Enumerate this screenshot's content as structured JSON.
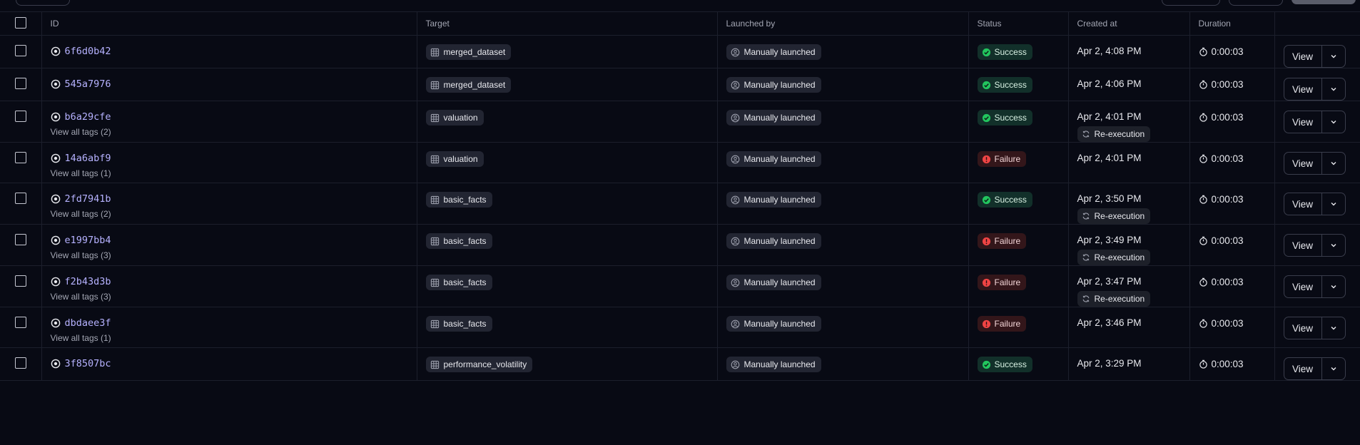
{
  "table": {
    "headers": {
      "id": "ID",
      "target": "Target",
      "launched_by": "Launched by",
      "status": "Status",
      "created_at": "Created at",
      "duration": "Duration"
    },
    "view_label": "View",
    "rows": [
      {
        "id": "6f6d0b42",
        "tags": "",
        "target": "merged_dataset",
        "launched_by": "Manually launched",
        "status": "Success",
        "created": "Apr 2, 4:08 PM",
        "reexec": "",
        "duration": "0:00:03"
      },
      {
        "id": "545a7976",
        "tags": "",
        "target": "merged_dataset",
        "launched_by": "Manually launched",
        "status": "Success",
        "created": "Apr 2, 4:06 PM",
        "reexec": "",
        "duration": "0:00:03"
      },
      {
        "id": "b6a29cfe",
        "tags": "View all tags (2)",
        "target": "valuation",
        "launched_by": "Manually launched",
        "status": "Success",
        "created": "Apr 2, 4:01 PM",
        "reexec": "Re-execution",
        "duration": "0:00:03"
      },
      {
        "id": "14a6abf9",
        "tags": "View all tags (1)",
        "target": "valuation",
        "launched_by": "Manually launched",
        "status": "Failure",
        "created": "Apr 2, 4:01 PM",
        "reexec": "",
        "duration": "0:00:03"
      },
      {
        "id": "2fd7941b",
        "tags": "View all tags (2)",
        "target": "basic_facts",
        "launched_by": "Manually launched",
        "status": "Success",
        "created": "Apr 2, 3:50 PM",
        "reexec": "Re-execution",
        "duration": "0:00:03"
      },
      {
        "id": "e1997bb4",
        "tags": "View all tags (3)",
        "target": "basic_facts",
        "launched_by": "Manually launched",
        "status": "Failure",
        "created": "Apr 2, 3:49 PM",
        "reexec": "Re-execution",
        "duration": "0:00:03"
      },
      {
        "id": "f2b43d3b",
        "tags": "View all tags (3)",
        "target": "basic_facts",
        "launched_by": "Manually launched",
        "status": "Failure",
        "created": "Apr 2, 3:47 PM",
        "reexec": "Re-execution",
        "duration": "0:00:03"
      },
      {
        "id": "dbdaee3f",
        "tags": "View all tags (1)",
        "target": "basic_facts",
        "launched_by": "Manually launched",
        "status": "Failure",
        "created": "Apr 2, 3:46 PM",
        "reexec": "",
        "duration": "0:00:03"
      },
      {
        "id": "3f8507bc",
        "tags": "",
        "target": "performance_volatility",
        "launched_by": "Manually launched",
        "status": "Success",
        "created": "Apr 2, 3:29 PM",
        "reexec": "",
        "duration": "0:00:03"
      }
    ]
  },
  "colors": {
    "background": "#080a14",
    "success": "#22c55e",
    "failure": "#ef4444",
    "run_id": "#b6b2ff"
  },
  "icons": {
    "run": "run-icon",
    "target": "table-grid-icon",
    "launched_by": "user-icon",
    "success": "check-circle-icon",
    "failure": "alert-circle-icon",
    "reexec": "refresh-icon",
    "duration": "timer-icon",
    "more": "chevron-down-icon"
  }
}
